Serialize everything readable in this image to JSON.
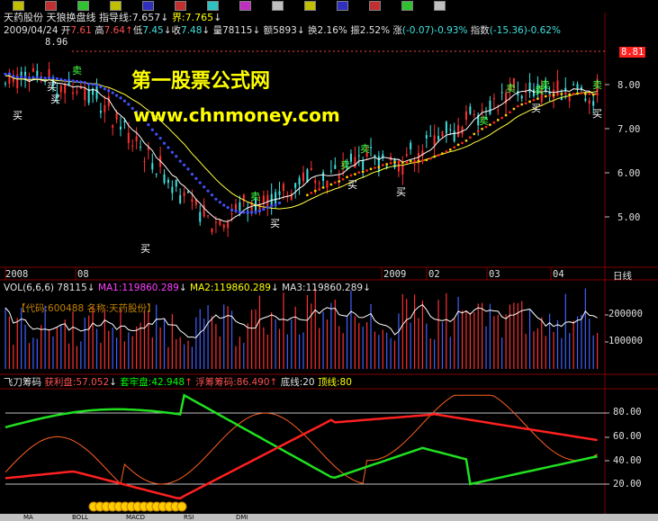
{
  "colors": {
    "bg": "#000000",
    "up": "#ff3030",
    "down": "#40e0e0",
    "ma_white": "#ffffff",
    "ma_yellow": "#ffff40",
    "ma_blue": "#4050ff",
    "green": "#20e020",
    "red": "#ff2020",
    "orange": "#ff6020",
    "grid": "#800000"
  },
  "header": {
    "stock_name": "天药股份",
    "indicator_name": "天狼换盘线",
    "zhidao_label": "指导线:",
    "zhidao_value": "7.657",
    "jie_label": "界:",
    "jie_value": "7.765"
  },
  "quote": {
    "date": "2009/04/24",
    "open_label": "开",
    "open": "7.61",
    "high_label": "高",
    "high": "7.64",
    "low_label": "低",
    "low": "7.45",
    "close_label": "收",
    "close": "7.48",
    "vol_label": "量",
    "vol": "78115",
    "amount_label": "额",
    "amount": "5893",
    "turnover_label": "换",
    "turnover": "2.16%",
    "amplitude_label": "振",
    "amplitude": "2.52%",
    "change_label": "涨",
    "change": "(-0.07)-0.93%",
    "index_label": "指数",
    "index": "(-15.36)-0.62%"
  },
  "price_axis": {
    "ticks": [
      "8.00",
      "7.00",
      "6.00",
      "5.00"
    ],
    "last_price_marker": "8.81",
    "high_marker": "8.96"
  },
  "brand": {
    "line1": "第一股票公式网",
    "line2": "www.chnmoney.com"
  },
  "time_axis": {
    "labels": [
      "2008",
      "08",
      "2009",
      "02",
      "03",
      "04"
    ],
    "period": "日线"
  },
  "signals": [
    {
      "text": "买",
      "kind": "buy"
    },
    {
      "text": "买",
      "kind": "buy"
    },
    {
      "text": "卖",
      "kind": "sell"
    },
    {
      "text": "买",
      "kind": "buy"
    },
    {
      "text": "买",
      "kind": "buy"
    },
    {
      "text": "卖",
      "kind": "sell"
    },
    {
      "text": "买",
      "kind": "buy"
    },
    {
      "text": "卖",
      "kind": "sell"
    },
    {
      "text": "卖",
      "kind": "sell"
    },
    {
      "text": "买",
      "kind": "buy"
    },
    {
      "text": "买",
      "kind": "buy"
    },
    {
      "text": "卖",
      "kind": "sell"
    },
    {
      "text": "卖",
      "kind": "sell"
    },
    {
      "text": "卖",
      "kind": "sell"
    },
    {
      "text": "卖",
      "kind": "sell"
    },
    {
      "text": "买",
      "kind": "buy"
    },
    {
      "text": "卖",
      "kind": "sell"
    },
    {
      "text": "买",
      "kind": "buy"
    }
  ],
  "volume": {
    "title": "VOL(6,6,6)",
    "vol_value": "78115",
    "ma1_label": "MA1:",
    "ma1": "119860.289",
    "ma2_label": "MA2:",
    "ma2": "119860.289",
    "ma3_label": "MA3:",
    "ma3": "119860.289",
    "stock_info": "【代码:600488 名称:天药股份】",
    "ticks": [
      "200000",
      "100000"
    ]
  },
  "feidao": {
    "title": "飞刀筹码",
    "profit_label": "获利盘:",
    "profit": "57.052",
    "trapped_label": "套牢盘:",
    "trapped": "42.948",
    "float_label": "浮筹筹码:",
    "float": "86.490",
    "bottom_label": "底线:",
    "bottom": "20",
    "top_label": "顶线:",
    "top": "80",
    "ticks": [
      "80.00",
      "60.00",
      "40.00",
      "20.00"
    ]
  },
  "tabs": [
    "MA",
    "BOLL",
    "MACD",
    "RSI",
    "DMI"
  ]
}
